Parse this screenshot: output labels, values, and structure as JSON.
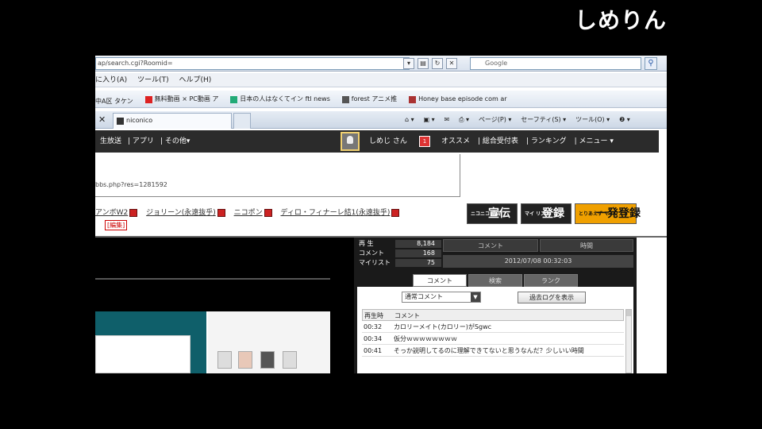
{
  "watermark": "しめりん",
  "browser": {
    "address_value": "ap/search.cgi?Roomid=",
    "search_placeholder": "Google",
    "menu": [
      "に入り(A)",
      "ツール(T)",
      "ヘルプ(H)"
    ],
    "favorites": [
      "中A区 タケン",
      "無料動画 × PC動画 ア",
      "日本の人はなくてイン ftl news",
      "forest アニメ推",
      "Honey base episode com ar"
    ],
    "tab_label": "niconico",
    "commands": [
      "ページ(P) ▾",
      "セーフティ(S) ▾",
      "ツール(O) ▾",
      "❷ ▾"
    ]
  },
  "nico_nav": {
    "left_items": [
      "生放送",
      "アプリ",
      "その他▾"
    ],
    "user_name": "しめじ さん",
    "badge": "1",
    "right_items": [
      "オススメ",
      "総合受付表",
      "ランキング",
      "メニュー ▾"
    ]
  },
  "info": {
    "url_text": "bbs.php?res=1281592"
  },
  "tags": [
    "アンボW2",
    "ジョリーン(永遠抜乎)",
    "ニコポン",
    "ディロ・フィナーレ結1(永遠抜乎)"
  ],
  "edit_tag": "[編集]",
  "ads": {
    "ad1_small": "ニコニコ 広告",
    "ad1": "宣伝",
    "ad2_small": "マイ リスト",
    "ad2": "登録",
    "ad3_small": "とりあえず マイリスト",
    "ad3": "一発登録"
  },
  "panel": {
    "stats": [
      {
        "k": "再 生",
        "v": "8,184"
      },
      {
        "k": "コメント",
        "v": "168"
      },
      {
        "k": "マイリスト",
        "v": "75"
      }
    ],
    "header_comment": "コメント",
    "header_time": "時間",
    "date": "2012/07/08 00:32:03",
    "tabs": [
      "コメント",
      "検索",
      "ランク"
    ],
    "select_value": "通常コメント",
    "log_button": "過去ログを表示",
    "table_head": {
      "t": "再生時",
      "c": "コメント"
    },
    "comments": [
      {
        "t": "00:32",
        "c": "カロリーメイト(カロリー)がSgwc"
      },
      {
        "t": "00:34",
        "c": "仮分ｗｗｗｗｗｗｗｗ"
      },
      {
        "t": "00:41",
        "c": "そっか説明してるのに理解できてないと思うなんだ？少しいい時間"
      }
    ]
  }
}
